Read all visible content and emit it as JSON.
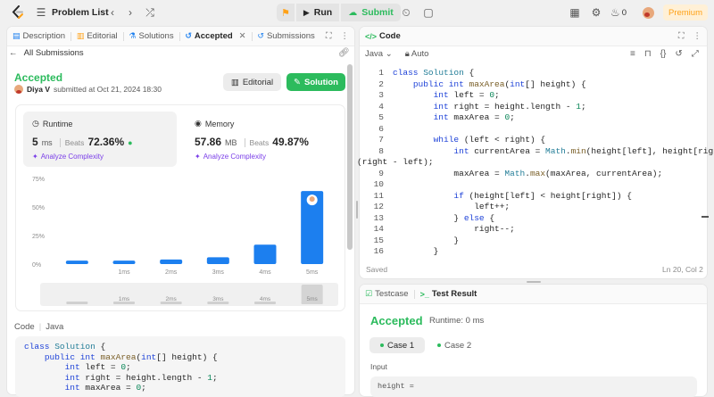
{
  "topbar": {
    "title": "Problem List",
    "run_label": "Run",
    "submit_label": "Submit",
    "fire_count": "0",
    "premium_label": "Premium"
  },
  "left_tabs": [
    {
      "label": "Description"
    },
    {
      "label": "Editorial"
    },
    {
      "label": "Solutions"
    },
    {
      "label": "Accepted"
    },
    {
      "label": "Submissions"
    }
  ],
  "submission": {
    "back_label": "All Submissions",
    "status": "Accepted",
    "user": "Diya V",
    "submitted_text": "submitted at Oct 21, 2024 18:30",
    "editorial_btn": "Editorial",
    "solution_btn": "Solution"
  },
  "runtime": {
    "title": "Runtime",
    "value": "5",
    "unit": "ms",
    "beats_label": "Beats",
    "beats_value": "72.36%",
    "analyze": "Analyze Complexity"
  },
  "memory": {
    "title": "Memory",
    "value": "57.86",
    "unit": "MB",
    "beats_label": "Beats",
    "beats_value": "49.87%",
    "analyze": "Analyze Complexity"
  },
  "chart_data": {
    "type": "bar",
    "categories": [
      "",
      "1ms",
      "2ms",
      "3ms",
      "4ms",
      "5ms"
    ],
    "values": [
      3,
      3,
      4,
      6,
      17,
      64
    ],
    "highlighted_category": "5ms",
    "ylim": [
      0,
      75
    ],
    "yticks": [
      "0%",
      "25%",
      "50%",
      "75%"
    ],
    "ytick_values": [
      0,
      25,
      50,
      75
    ],
    "bar_color": "#1c7fef",
    "grid": false
  },
  "left_code": {
    "header": "Code",
    "lang": "Java",
    "lines": [
      "class Solution {",
      "    public int maxArea(int[] height) {",
      "        int left = 0;",
      "        int right = height.length - 1;",
      "        int maxArea = 0;"
    ]
  },
  "editor": {
    "tab_label": "Code",
    "language": "Java",
    "auto_label": "Auto",
    "status": "Saved",
    "cursor": "Ln 20, Col 2",
    "line_numbers": [
      "1",
      "2",
      "3",
      "4",
      "5",
      "6",
      "7",
      "8",
      "",
      "9",
      "10",
      "11",
      "12",
      "13",
      "14",
      "15",
      "16"
    ]
  },
  "result": {
    "testcase_tab": "Testcase",
    "result_tab": "Test Result",
    "status": "Accepted",
    "runtime": "Runtime: 0 ms",
    "case1": "Case 1",
    "case2": "Case 2",
    "input_label": "Input",
    "input_value": "height ="
  },
  "colors": {
    "accent_green": "#2cbb5d",
    "brand_orange": "#ffa116",
    "purple": "#7a3ee8"
  }
}
